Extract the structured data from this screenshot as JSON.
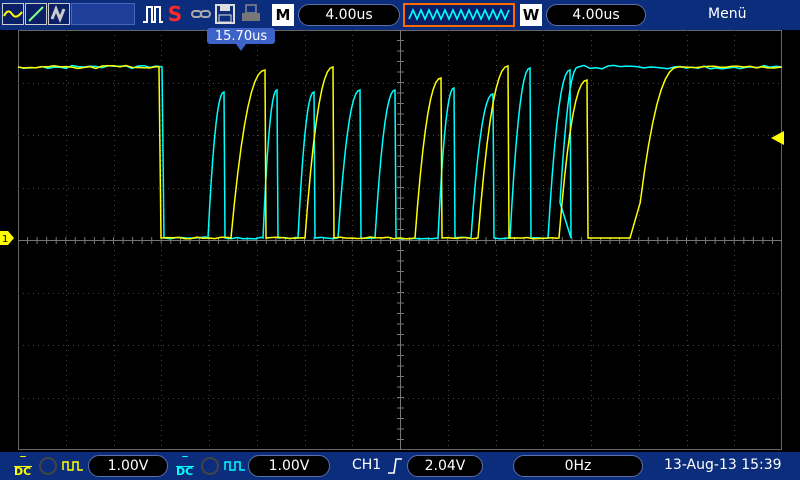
{
  "toolbar": {
    "icons": [
      "ch1-wave-icon",
      "edit-icon",
      "ref-icon",
      "blank-slot",
      "run-pulse-icon",
      "single-s-icon",
      "chain-icon",
      "save-icon",
      "print-icon"
    ],
    "single_label": "S",
    "mode_label": "M",
    "timebase": "4.00us",
    "window_label": "W",
    "window_time": "4.00us",
    "menu": "Menü"
  },
  "cursor": {
    "time": "15.70us"
  },
  "bottom": {
    "ch1_coupling": "DC",
    "ch1_scale": "1.00V",
    "ch2_coupling": "DC",
    "ch2_scale": "1.00V",
    "trigger_channel": "CH1",
    "trigger_level": "2.04V",
    "frequency": "0Hz",
    "datetime": "13-Aug-13 15:39"
  },
  "colors": {
    "ch1": "#ffff00",
    "ch2": "#00ffff",
    "bar": "#0b2d7c",
    "accent": "#ff6a00"
  }
}
